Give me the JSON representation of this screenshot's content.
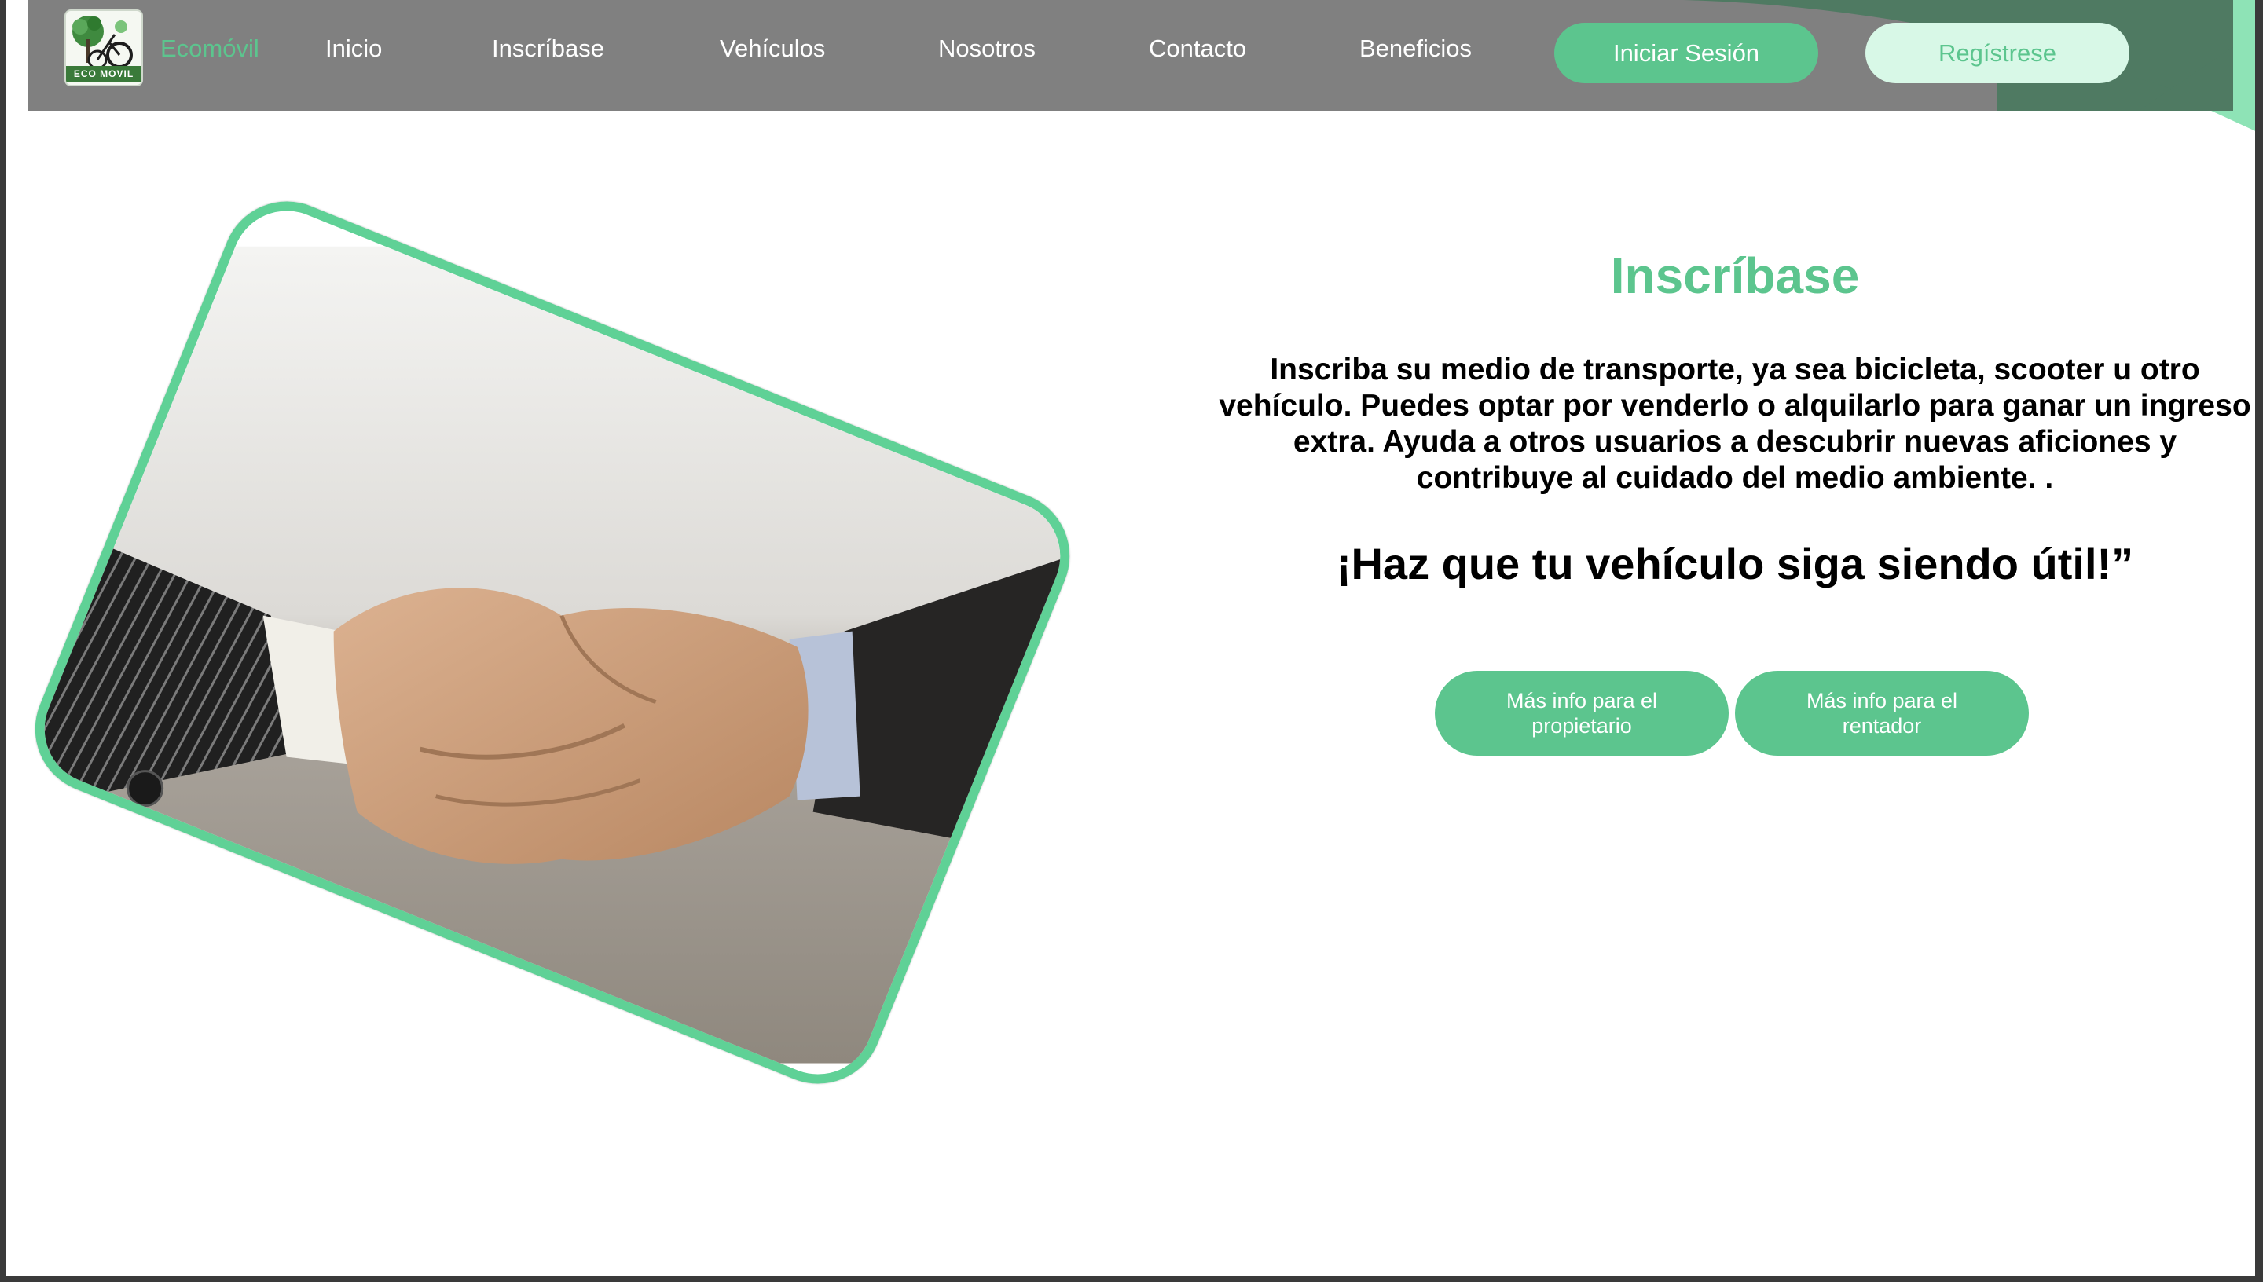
{
  "nav": {
    "logo_alt": "ECO MOVIL",
    "brand": "Ecomóvil",
    "links": [
      "Inicio",
      "Inscríbase",
      "Vehículos",
      "Nosotros",
      "Contacto",
      "Beneficios"
    ],
    "login_label": "Iniciar Sesión",
    "register_label": "Regístrese"
  },
  "hero": {
    "title": "Inscríbase",
    "description": "Inscriba su medio de transporte, ya sea bicicleta, scooter u otro vehículo. Puedes optar por venderlo o alquilarlo para ganar un ingreso extra. Ayuda a otros usuarios a descubrir nuevas aficiones y contribuye al cuidado del medio ambiente. .",
    "tagline": "¡Haz que tu vehículo siga siendo útil!”",
    "buttons": [
      "Más info para el propietario",
      "Más info para el rentador"
    ]
  },
  "colors": {
    "accent": "#5cc58e",
    "accent_light": "#d8f8e7",
    "nav_bg": "#808080",
    "frame": "#5fd196"
  }
}
